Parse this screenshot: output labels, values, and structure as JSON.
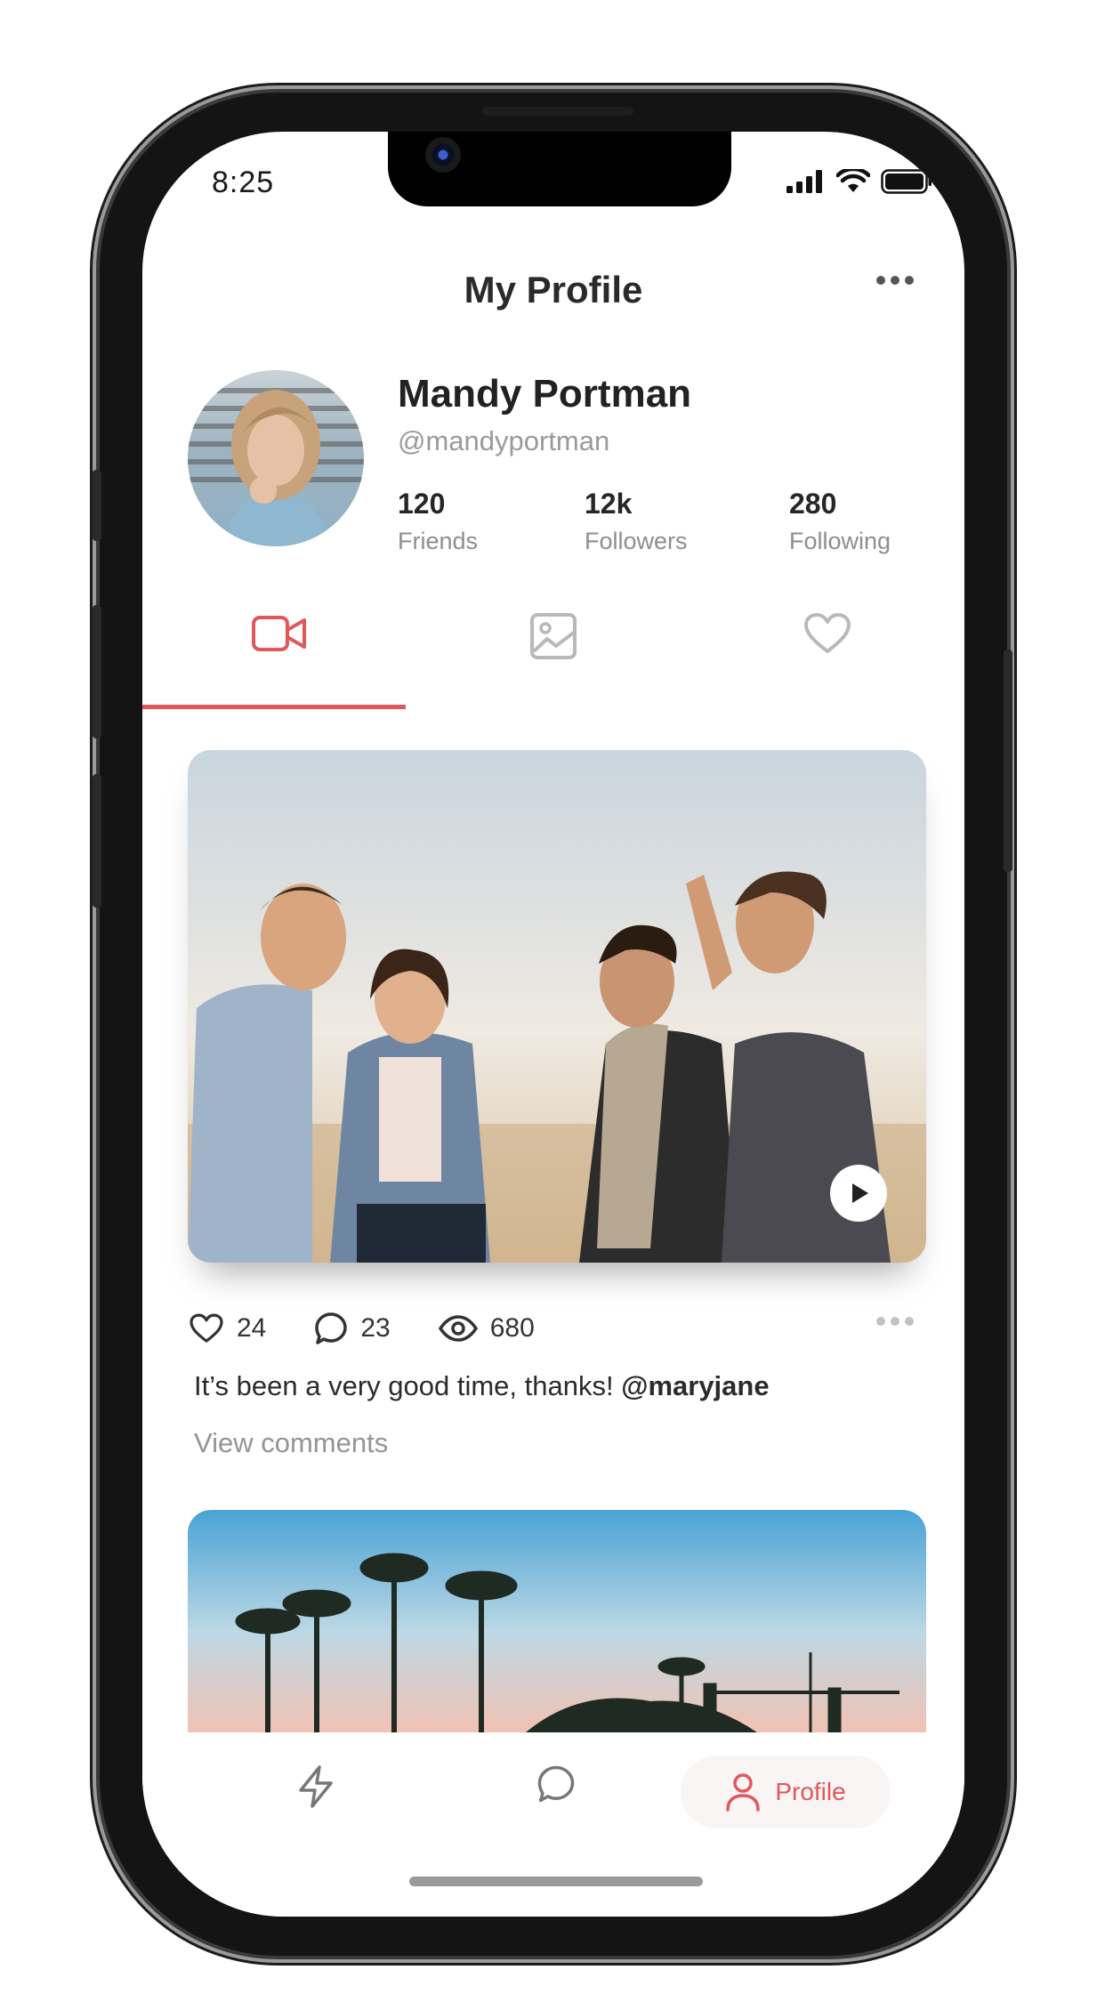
{
  "status_bar": {
    "time": "8:25"
  },
  "header": {
    "title": "My Profile"
  },
  "profile": {
    "name": "Mandy Portman",
    "handle": "@mandyportman",
    "stats": [
      {
        "value": "120",
        "label": "Friends"
      },
      {
        "value": "12k",
        "label": "Followers"
      },
      {
        "value": "280",
        "label": "Following"
      }
    ]
  },
  "tabs": [
    {
      "icon": "video-icon",
      "active": true
    },
    {
      "icon": "image-icon",
      "active": false
    },
    {
      "icon": "heart-icon",
      "active": false
    }
  ],
  "post": {
    "likes": "24",
    "comments": "23",
    "views": "680",
    "caption": "It’s been a very good time, thanks!",
    "mention": "@maryjane",
    "view_comments": "View comments"
  },
  "bottom_nav": {
    "profile_label": "Profile"
  },
  "colors": {
    "accent": "#e0585b",
    "text": "#2a2a2a",
    "muted": "#949494"
  }
}
